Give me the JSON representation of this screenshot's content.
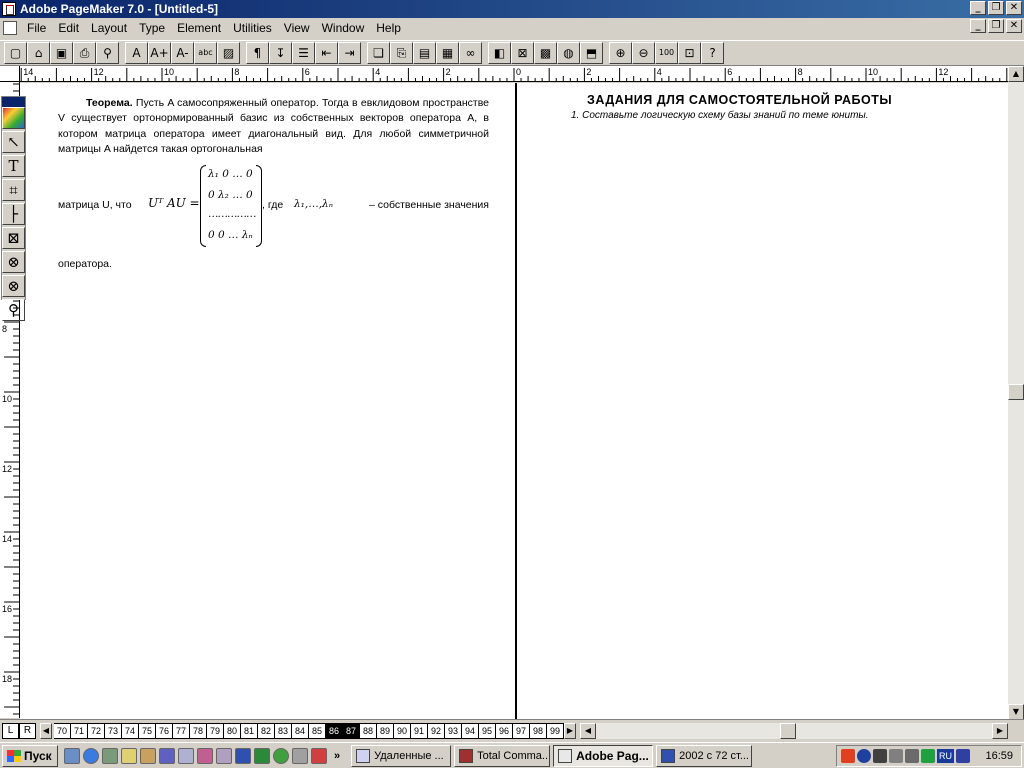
{
  "window": {
    "title": "Adobe PageMaker 7.0 - [Untitled-5]",
    "btn_minimize": "_",
    "btn_restore": "❐",
    "btn_close": "✕"
  },
  "menu": {
    "items": [
      "File",
      "Edit",
      "Layout",
      "Type",
      "Element",
      "Utilities",
      "View",
      "Window",
      "Help"
    ]
  },
  "toolbar": {
    "buttons": [
      {
        "name": "new-icon",
        "glyph": "▢"
      },
      {
        "name": "open-icon",
        "glyph": "⌂"
      },
      {
        "name": "save-icon",
        "glyph": "▣"
      },
      {
        "name": "print-icon",
        "glyph": "⎙"
      },
      {
        "name": "find-icon",
        "glyph": "⚲"
      },
      {
        "name": "character-icon",
        "glyph": "A"
      },
      {
        "name": "font-size-up-icon",
        "glyph": "A+"
      },
      {
        "name": "font-size-down-icon",
        "glyph": "A-"
      },
      {
        "name": "spelling-icon",
        "glyph": "abc"
      },
      {
        "name": "fill-icon",
        "glyph": "▨"
      },
      {
        "name": "paragraph-icon",
        "glyph": "¶"
      },
      {
        "name": "indent-tab-icon",
        "glyph": "↧"
      },
      {
        "name": "bullets-icon",
        "glyph": "☰"
      },
      {
        "name": "indent-left-icon",
        "glyph": "⇤"
      },
      {
        "name": "indent-right-icon",
        "glyph": "⇥"
      },
      {
        "name": "copy-page-icon",
        "glyph": "❏"
      },
      {
        "name": "copy-icon",
        "glyph": "⎘"
      },
      {
        "name": "paste-icon",
        "glyph": "▤"
      },
      {
        "name": "place-icon",
        "glyph": "▦"
      },
      {
        "name": "link-icon",
        "glyph": "∞"
      },
      {
        "name": "color-icon",
        "glyph": "◧"
      },
      {
        "name": "mask-icon",
        "glyph": "⊠"
      },
      {
        "name": "image-icon",
        "glyph": "▩"
      },
      {
        "name": "globe-icon",
        "glyph": "◍"
      },
      {
        "name": "export-pdf-icon",
        "glyph": "⬒"
      },
      {
        "name": "zoom-in-icon",
        "glyph": "⊕"
      },
      {
        "name": "zoom-out-icon",
        "glyph": "⊖"
      },
      {
        "name": "actual-size-icon",
        "glyph": "100"
      },
      {
        "name": "fit-window-icon",
        "glyph": "⊡"
      },
      {
        "name": "help-icon",
        "glyph": "?"
      }
    ]
  },
  "rulers": {
    "horizontal_labels": [
      "14",
      "12",
      "10",
      "8",
      "6",
      "4",
      "2",
      "0",
      "2",
      "4",
      "6",
      "8",
      "10",
      "12",
      "14"
    ],
    "vertical_labels": [
      "8",
      "10",
      "12",
      "14",
      "16",
      "18"
    ]
  },
  "toolbox": {
    "tools": [
      {
        "name": "pointer-tool-icon",
        "glyph": "↖"
      },
      {
        "name": "text-tool-icon",
        "glyph": "T"
      },
      {
        "name": "crop-tool-icon",
        "glyph": "⌗"
      },
      {
        "name": "line-tool-icon",
        "glyph": "├"
      },
      {
        "name": "rectangle-frame-tool-icon",
        "glyph": "⊠"
      },
      {
        "name": "ellipse-tool-icon",
        "glyph": "⊗"
      },
      {
        "name": "polygon-tool-icon",
        "glyph": "⊗"
      },
      {
        "name": "zoom-tool-icon",
        "glyph": "⚲"
      }
    ]
  },
  "document": {
    "left": {
      "heading": "Теорема.",
      "paragraph": "Пусть A самосопряженный оператор. Тогда в евклидовом пространстве V существует ортонормированный базис из собственных векторов оператора A, в котором матрица оператора имеет диагональный вид. Для любой симметричной матрицы A найдется такая ортогональная",
      "formula_prefix": "матрица U, что",
      "formula_lhs": "Uᵀ AU =",
      "matrix_rows": [
        "λ₁  0 … 0",
        "0  λ₂ … 0",
        "……………",
        "0  0 … λₙ"
      ],
      "formula_suffix": ", где",
      "eigen_list": "λ₁,…,λₙ",
      "formula_tail": "– собственные значения",
      "closing": "оператора."
    },
    "right": {
      "title": "ЗАДАНИЯ ДЛЯ САМОСТОЯТЕЛЬНОЙ РАБОТЫ",
      "item": "1.  Составьте логическую схему базы знаний по теме юниты."
    }
  },
  "pagebar": {
    "left_label": "L",
    "right_label": "R",
    "pages": [
      "70",
      "71",
      "72",
      "73",
      "74",
      "75",
      "76",
      "77",
      "78",
      "79",
      "80",
      "81",
      "82",
      "83",
      "84",
      "85",
      "86",
      "87",
      "88",
      "89",
      "90",
      "91",
      "92",
      "93",
      "94",
      "95",
      "96",
      "97",
      "98",
      "99"
    ],
    "active_pages": [
      "86",
      "87"
    ]
  },
  "taskbar": {
    "start_label": "Пуск",
    "overflow_label": "»",
    "tasks": [
      {
        "label": "Удаленные ...",
        "active": false,
        "name": "task-deleted"
      },
      {
        "label": "Total Comma...",
        "active": false,
        "name": "task-total-commander"
      },
      {
        "label": "Adobe Pag...",
        "active": true,
        "name": "task-adobe-pagemaker"
      },
      {
        "label": "2002 с 72 ст...",
        "active": false,
        "name": "task-word-document"
      }
    ],
    "tray_lang": "RU",
    "clock": "16:59"
  }
}
